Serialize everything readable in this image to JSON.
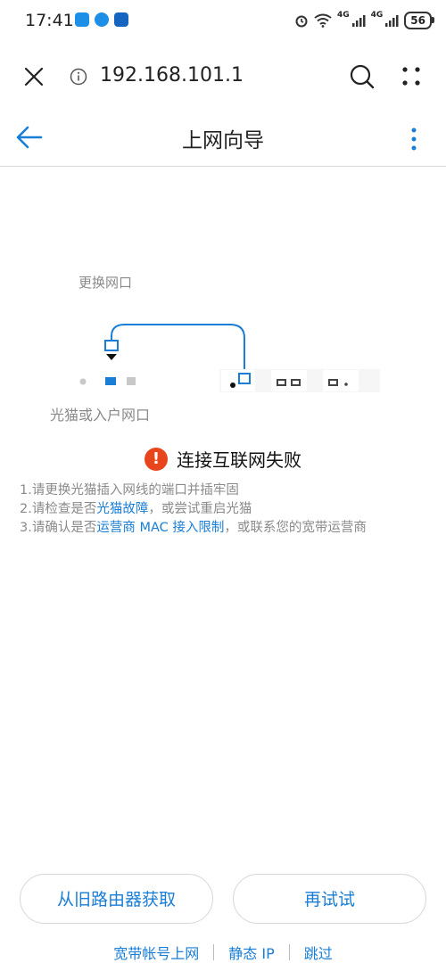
{
  "status_bar": {
    "time": "17:41",
    "battery": "56",
    "net1": "4G",
    "net2": "4G"
  },
  "browser": {
    "url": "192.168.101.1"
  },
  "header": {
    "title": "上网向导"
  },
  "diagram": {
    "change_port_hint": "更换网口",
    "modem_port_label": "光猫或入户网口"
  },
  "error": {
    "title": "连接互联网失败"
  },
  "tips": [
    {
      "prefix": "1.请更换光猫插入网线的端口并插牢固"
    },
    {
      "prefix": "2.请检查是否",
      "link": "光猫故障",
      "suffix": "，或尝试重启光猫"
    },
    {
      "prefix": "3.请确认是否",
      "link": "运营商 MAC 接入限制",
      "suffix": "，或联系您的宽带运营商"
    }
  ],
  "buttons": {
    "get_from_old_router": "从旧路由器获取",
    "retry": "再试试"
  },
  "bottom_links": {
    "pppoe": "宽带帐号上网",
    "static_ip": "静态 IP",
    "skip": "跳过"
  },
  "colors": {
    "accent": "#1a7ed6",
    "error": "#e8451c"
  }
}
